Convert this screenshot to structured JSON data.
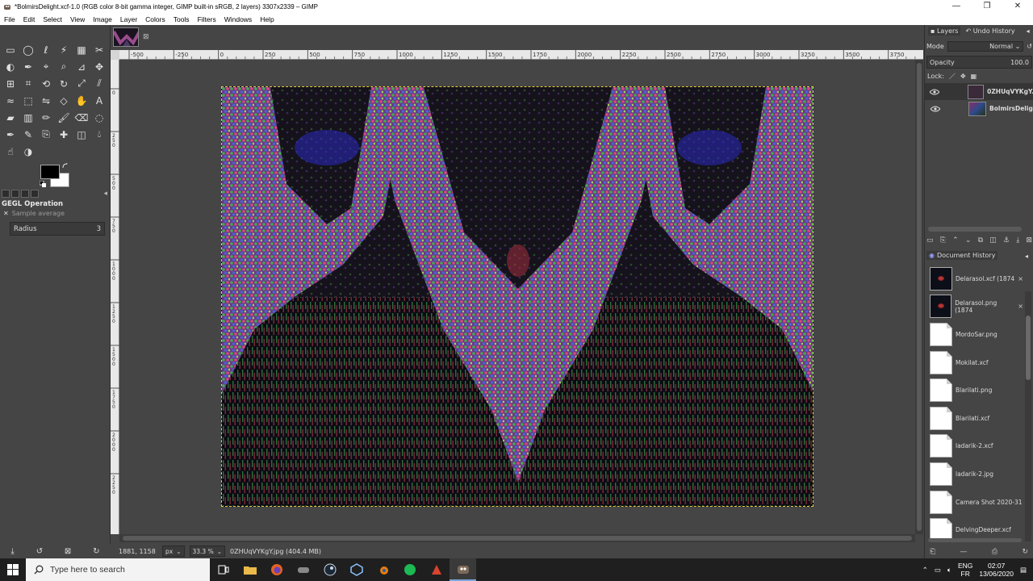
{
  "window": {
    "title": "*BolmirsDelight.xcf-1.0 (RGB color 8-bit gamma integer, GIMP built-in sRGB, 2 layers) 3307x2339 – GIMP",
    "minimize": "—",
    "maximize": "❐",
    "close": "✕"
  },
  "menu": [
    "File",
    "Edit",
    "Select",
    "View",
    "Image",
    "Layer",
    "Colors",
    "Tools",
    "Filters",
    "Windows",
    "Help"
  ],
  "toolbox": {
    "tools": [
      "rect-select-icon",
      "ellipse-select-icon",
      "lasso-icon",
      "fuzzy-select-icon",
      "by-color-select-icon",
      "scissors-icon",
      "foreground-select-icon",
      "paths-icon",
      "color-picker-icon",
      "zoom-icon",
      "measure-icon",
      "move-icon",
      "align-icon",
      "crop-icon",
      "unified-transform-icon",
      "rotate-icon",
      "scale-icon",
      "shear-icon",
      "warp-icon",
      "cage-icon",
      "flip-icon",
      "perspective-icon",
      "handle-transform-icon",
      "text-icon",
      "bucket-fill-icon",
      "gradient-icon",
      "pencil-icon",
      "paintbrush-icon",
      "eraser-icon",
      "airbrush-icon",
      "ink-icon",
      "mypaint-brush-icon",
      "clone-icon",
      "heal-icon",
      "perspective-clone-icon",
      "blur-icon",
      "smudge-icon",
      "dodge-burn-icon"
    ],
    "fg_color": "#000000",
    "bg_color": "#ffffff"
  },
  "tool_options": {
    "title": "GEGL Operation",
    "sample_average": "Sample average",
    "radius_label": "Radius",
    "radius_value": "3"
  },
  "ruler": {
    "h_ticks": [
      "-500",
      "-250",
      "0",
      "250",
      "500",
      "750",
      "1000",
      "1250",
      "1500",
      "1750",
      "2000",
      "2250",
      "2500",
      "2750",
      "3000",
      "3250",
      "3500",
      "3750"
    ],
    "v_ticks": [
      "0",
      "2 5 0",
      "5 0 0",
      "7 5 0",
      "1 0 0 0",
      "1 2 5 0",
      "1 5 0 0",
      "1 7 5 0",
      "2 0 0 0",
      "2 2 5 0"
    ]
  },
  "status": {
    "coords": "1881, 1158",
    "unit": "px",
    "zoom": "33.3 %",
    "message": "0ZHUqVYKgY.jpg (404.4 MB)"
  },
  "layers_panel": {
    "tab_layers": "Layers",
    "tab_undo": "Undo History",
    "mode_label": "Mode",
    "mode_value": "Normal",
    "opacity_label": "Opacity",
    "opacity_value": "100.0",
    "lock_label": "Lock:",
    "layers": [
      {
        "name": "0ZHUqVYKgY.",
        "visible": true,
        "selected": true
      },
      {
        "name": "BolmirsDelig",
        "visible": true,
        "selected": false
      }
    ]
  },
  "doc_history": {
    "title": "Document History",
    "items": [
      {
        "name": "Delarasol.xcf (1874",
        "thumb": "dark",
        "closable": true
      },
      {
        "name": "Delarasol.png (1874",
        "thumb": "dark",
        "closable": true
      },
      {
        "name": "MordoSar.png",
        "thumb": "file"
      },
      {
        "name": "Mokilat.xcf",
        "thumb": "file"
      },
      {
        "name": "Blarilati.png",
        "thumb": "file"
      },
      {
        "name": "Blarilati.xcf",
        "thumb": "file"
      },
      {
        "name": "ladarik-2.xcf",
        "thumb": "file"
      },
      {
        "name": "ladarik-2.jpg",
        "thumb": "file"
      },
      {
        "name": "Camera Shot 2020-31",
        "thumb": "file"
      },
      {
        "name": "DelvingDeeper.xcf",
        "thumb": "file"
      }
    ]
  },
  "taskbar": {
    "search_placeholder": "Type here to search",
    "lang_top": "ENG",
    "lang_bottom": "FR",
    "time": "02:07",
    "date": "13/06/2020"
  }
}
